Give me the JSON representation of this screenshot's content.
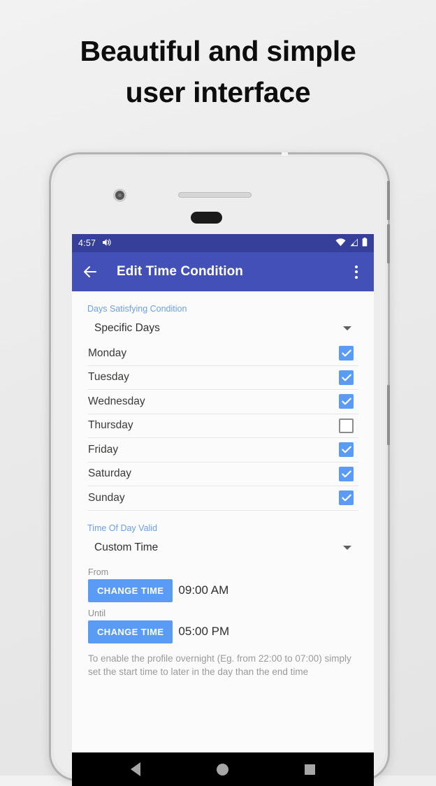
{
  "headline": {
    "line1": "Beautiful and simple",
    "line2": "user interface"
  },
  "phone": {
    "camera_icon": "camera-icon",
    "speaker_icon": "earpiece-speaker",
    "sensor_icon": "sensor-notch"
  },
  "status_bar": {
    "time": "4:57",
    "volume_icon": "volume-icon",
    "wifi_icon": "wifi-icon",
    "signal_icon": "signal-icon",
    "battery_icon": "battery-icon",
    "background": "#36409a"
  },
  "app_bar": {
    "title": "Edit Time Condition",
    "back_icon": "back-arrow-icon",
    "overflow_icon": "overflow-menu-icon",
    "background": "#4350b8"
  },
  "content": {
    "days_section": {
      "label": "Days Satisfying Condition",
      "spinner_value": "Specific Days",
      "days": [
        {
          "name": "Monday",
          "checked": true
        },
        {
          "name": "Tuesday",
          "checked": true
        },
        {
          "name": "Wednesday",
          "checked": true
        },
        {
          "name": "Thursday",
          "checked": false
        },
        {
          "name": "Friday",
          "checked": true
        },
        {
          "name": "Saturday",
          "checked": true
        },
        {
          "name": "Sunday",
          "checked": true
        }
      ]
    },
    "time_section": {
      "label": "Time Of Day Valid",
      "spinner_value": "Custom Time",
      "from_label": "From",
      "from_button": "CHANGE TIME",
      "from_value": "09:00 AM",
      "until_label": "Until",
      "until_button": "CHANGE TIME",
      "until_value": "05:00 PM",
      "hint": "To enable the profile overnight (Eg. from 22:00 to 07:00) simply set the start time to later in the day than the end time"
    }
  },
  "nav_bar": {
    "back_icon": "nav-back-icon",
    "home_icon": "nav-home-icon",
    "recents_icon": "nav-recents-icon"
  },
  "colors": {
    "accent_blue": "#5a9cf5",
    "label_blue": "#6a9fe8",
    "appbar_indigo": "#4350b8",
    "statusbar_indigo": "#36409a"
  }
}
